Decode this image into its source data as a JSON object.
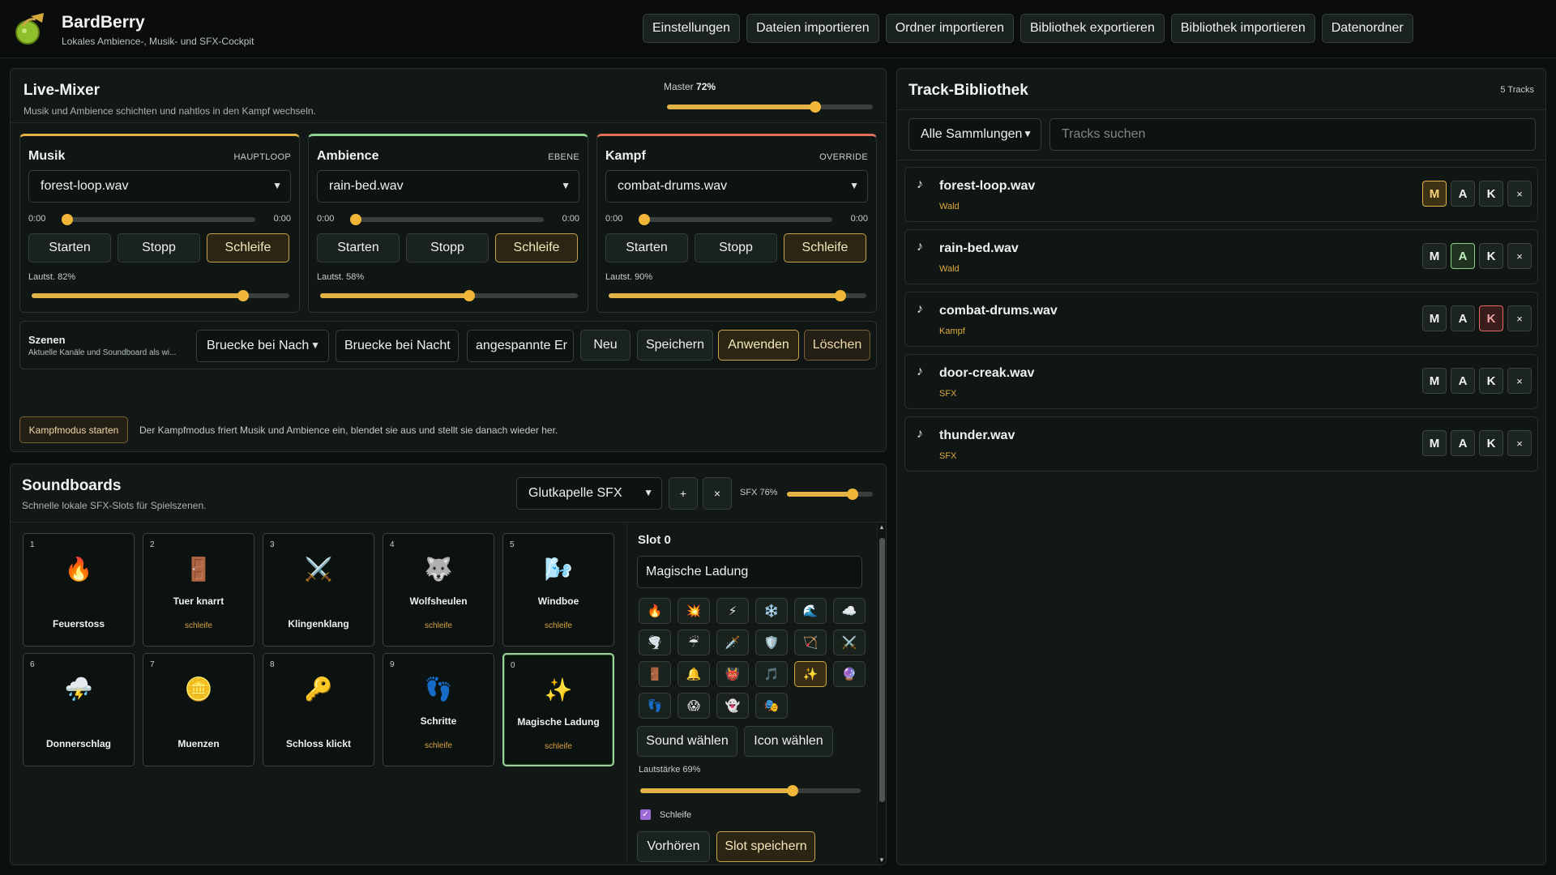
{
  "app": {
    "title": "BardBerry",
    "subtitle": "Lokales Ambience-, Musik- und SFX-Cockpit"
  },
  "topnav": [
    "Einstellungen",
    "Dateien importieren",
    "Ordner importieren",
    "Bibliothek exportieren",
    "Bibliothek importieren",
    "Datenordner"
  ],
  "mixer": {
    "title": "Live-Mixer",
    "subtitle": "Musik und Ambience schichten und nahtlos in den Kampf wechseln.",
    "master_label": "Master",
    "master_value": "72%",
    "master_level": 0.72,
    "channels": [
      {
        "name": "Musik",
        "tag": "HAUPTLOOP",
        "file": "forest-loop.wav",
        "time_start": "0:00",
        "time_end": "0:00",
        "volume_label": "Lautst. 82%",
        "volume": 0.82,
        "accent": "#e2b247"
      },
      {
        "name": "Ambience",
        "tag": "EBENE",
        "file": "rain-bed.wav",
        "time_start": "0:00",
        "time_end": "0:00",
        "volume_label": "Lautst. 58%",
        "volume": 0.58,
        "accent": "#8fd18f"
      },
      {
        "name": "Kampf",
        "tag": "OVERRIDE",
        "file": "combat-drums.wav",
        "time_start": "0:00",
        "time_end": "0:00",
        "volume_label": "Lautst. 90%",
        "volume": 0.9,
        "accent": "#e0705a"
      }
    ],
    "channel_buttons": {
      "start": "Starten",
      "stop": "Stopp",
      "loop": "Schleife"
    },
    "scenes": {
      "title": "Szenen",
      "subtitle": "Aktuelle Kanäle und Soundboard als wi...",
      "selected": "Bruecke bei Nach",
      "name_value": "Bruecke bei Nacht",
      "mood_value": "angespannte Er",
      "new": "Neu",
      "save": "Speichern",
      "apply": "Anwenden",
      "delete": "Löschen"
    },
    "combat": {
      "button": "Kampfmodus starten",
      "info": "Der Kampfmodus friert Musik und Ambience ein, blendet sie aus und stellt sie danach wieder her."
    }
  },
  "soundboards": {
    "title": "Soundboards",
    "subtitle": "Schnelle lokale SFX-Slots für Spielszenen.",
    "selected_board": "Glutkapelle SFX",
    "add": "+",
    "remove": "×",
    "sfx_label": "SFX 76%",
    "sfx_level": 0.76,
    "slots": [
      {
        "num": "1",
        "icon": "🔥",
        "icon_name": "fire-icon",
        "name": "Feuerstoss",
        "loop": ""
      },
      {
        "num": "2",
        "icon": "🚪",
        "icon_name": "door-icon",
        "name": "Tuer knarrt",
        "loop": "schleife"
      },
      {
        "num": "3",
        "icon": "⚔️",
        "icon_name": "crossed-swords-icon",
        "name": "Klingenklang",
        "loop": ""
      },
      {
        "num": "4",
        "icon": "🐺",
        "icon_name": "wolf-icon",
        "name": "Wolfsheulen",
        "loop": "schleife"
      },
      {
        "num": "5",
        "icon": "🌬️",
        "icon_name": "wind-icon",
        "name": "Windboe",
        "loop": "schleife"
      },
      {
        "num": "6",
        "icon": "⛈️",
        "icon_name": "storm-icon",
        "name": "Donnerschlag",
        "loop": ""
      },
      {
        "num": "7",
        "icon": "🪙",
        "icon_name": "coin-icon",
        "name": "Muenzen",
        "loop": ""
      },
      {
        "num": "8",
        "icon": "🔑",
        "icon_name": "key-icon",
        "name": "Schloss klickt",
        "loop": ""
      },
      {
        "num": "9",
        "icon": "👣",
        "icon_name": "footsteps-icon",
        "name": "Schritte",
        "loop": "schleife"
      },
      {
        "num": "0",
        "icon": "✨",
        "icon_name": "sparkles-icon",
        "name": "Magische Ladung",
        "loop": "schleife"
      }
    ],
    "editor": {
      "title": "Slot 0",
      "name_value": "Magische Ladung",
      "icons": [
        "🔥",
        "💥",
        "⚡",
        "❄️",
        "🌊",
        "☁️",
        "🌪️",
        "☔",
        "🗡️",
        "🛡️",
        "🏹",
        "⚔️",
        "🚪",
        "🔔",
        "👹",
        "🎵",
        "✨",
        "🔮",
        "👣",
        "😱",
        "👻",
        "🎭"
      ],
      "icon_names": [
        "fire-icon",
        "explosion-icon",
        "lightning-icon",
        "snowflake-icon",
        "wave-icon",
        "cloud-icon",
        "tornado-icon",
        "rain-icon",
        "dagger-icon",
        "shield-icon",
        "bow-icon",
        "crossed-swords-icon",
        "door-icon",
        "bell-icon",
        "ogre-icon",
        "music-icon",
        "sparkles-icon",
        "crystal-ball-icon",
        "footsteps-icon",
        "scream-icon",
        "ghost-icon",
        "masks-icon"
      ],
      "selected_icon_index": 16,
      "choose_sound": "Sound wählen",
      "choose_icon": "Icon wählen",
      "volume_label": "Lautstärke 69%",
      "volume": 0.69,
      "loop_label": "Schleife",
      "loop_checked": true,
      "preview": "Vorhören",
      "save": "Slot speichern"
    }
  },
  "library": {
    "title": "Track-Bibliothek",
    "count": "5 Tracks",
    "collection": "Alle Sammlungen",
    "search_placeholder": "Tracks suchen",
    "tracks": [
      {
        "name": "forest-loop.wav",
        "collection": "Wald",
        "active": "M"
      },
      {
        "name": "rain-bed.wav",
        "collection": "Wald",
        "active": "A"
      },
      {
        "name": "combat-drums.wav",
        "collection": "Kampf",
        "active": "K"
      },
      {
        "name": "door-creak.wav",
        "collection": "SFX",
        "active": ""
      },
      {
        "name": "thunder.wav",
        "collection": "SFX",
        "active": ""
      }
    ],
    "assign": {
      "m": "M",
      "a": "A",
      "k": "K",
      "x": "×"
    }
  },
  "colors": {
    "accent": "#e2b247",
    "ambience": "#8fd18f",
    "combat": "#e0705a",
    "bg": "#0b100e"
  }
}
